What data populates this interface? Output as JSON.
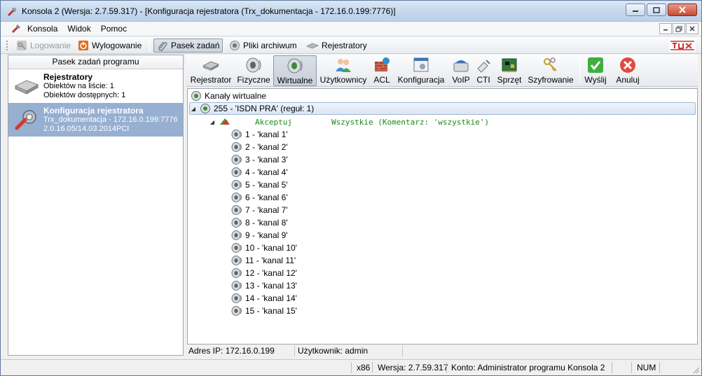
{
  "window": {
    "title": "Konsola 2 (Wersja:  2.7.59.317) - [Konfiguracja rejestratora (Trx_dokumentacja - 172.16.0.199:7776)]"
  },
  "menu": {
    "items": [
      "Konsola",
      "Widok",
      "Pomoc"
    ]
  },
  "toolbar1": {
    "logowanie": "Logowanie",
    "wylogowanie": "Wylogowanie",
    "pasek_zadan": "Pasek zadań",
    "pliki_archiwum": "Pliki archiwum",
    "rejestratory": "Rejestratory"
  },
  "left_panel": {
    "header": "Pasek zadań programu",
    "items": [
      {
        "title": "Rejestratory",
        "line1": "Obiektów na liście: 1",
        "line2": "Obiektów dostępnych: 1"
      },
      {
        "title": "Konfiguracja rejestratora",
        "line1": "Trx_dokumentacja - 172.16.0.199:7776",
        "line2": "2.0.16.05/14.03.2014PCI"
      }
    ]
  },
  "toolbar2": {
    "buttons": [
      "Rejestrator",
      "Fizyczne",
      "Wirtualne",
      "Użytkownicy",
      "ACL",
      "Konfiguracja",
      "VoIP",
      "CTI",
      "Sprzęt",
      "Szyfrowanie",
      "Wyślij",
      "Anuluj"
    ]
  },
  "tree": {
    "root": "Kanały wirtualne",
    "group": "255 - 'ISDN PRA' (reguł: 1)",
    "rule_action": "Akceptuj",
    "rule_desc": "Wszystkie (Komentarz: 'wszystkie')",
    "channels": [
      "1 - 'kanal 1'",
      "2 - 'kanal 2'",
      "3 - 'kanal 3'",
      "4 - 'kanal 4'",
      "5 - 'kanal 5'",
      "6 - 'kanal 6'",
      "7 - 'kanal 7'",
      "8 - 'kanal 8'",
      "9 - 'kanal 9'",
      "10 - 'kanal 10'",
      "11 - 'kanal 11'",
      "12 - 'kanal 12'",
      "13 - 'kanal 13'",
      "14 - 'kanal 14'",
      "15 - 'kanal 15'"
    ]
  },
  "inner_status": {
    "ip": "Adres IP: 172.16.0.199",
    "user": "Użytkownik: admin"
  },
  "status": {
    "arch": "x86",
    "version": "Wersja: 2.7.59.317",
    "account": "Konto: Administrator programu Konsola 2",
    "num": "NUM"
  }
}
